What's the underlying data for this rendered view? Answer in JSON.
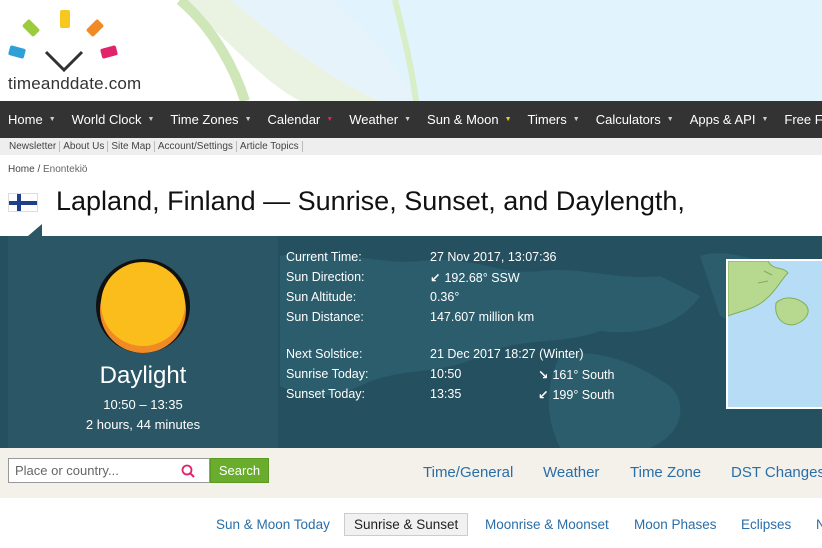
{
  "brand": {
    "logo_text": "timeanddate.com"
  },
  "nav": {
    "items": [
      {
        "label": "Home",
        "caret": "white"
      },
      {
        "label": "World Clock",
        "caret": "white"
      },
      {
        "label": "Time Zones",
        "caret": "white"
      },
      {
        "label": "Calendar",
        "caret": "red"
      },
      {
        "label": "Weather",
        "caret": "white"
      },
      {
        "label": "Sun & Moon",
        "caret": "yellow"
      },
      {
        "label": "Timers",
        "caret": "white"
      },
      {
        "label": "Calculators",
        "caret": "white"
      },
      {
        "label": "Apps & API",
        "caret": "white"
      },
      {
        "label": "Free Fun",
        "caret": "white"
      }
    ]
  },
  "subnav": {
    "items": [
      "Newsletter",
      "About Us",
      "Site Map",
      "Account/Settings",
      "Article Topics"
    ]
  },
  "breadcrumb": {
    "home": "Home /",
    "current": "Enontekiö"
  },
  "title": "Lapland, Finland — Sunrise, Sunset, and Daylength,",
  "sun": {
    "status": "Daylight",
    "range": "10:50 – 13:35",
    "duration": "2 hours, 44 minutes"
  },
  "info": {
    "current_time_label": "Current Time:",
    "current_time_value": "27 Nov 2017, 13:07:36",
    "direction_label": "Sun Direction:",
    "direction_value": "192.68° SSW",
    "altitude_label": "Sun Altitude:",
    "altitude_value": "0.36°",
    "distance_label": "Sun Distance:",
    "distance_value": "147.607 million km",
    "solstice_label": "Next Solstice:",
    "solstice_value": "21 Dec 2017 18:27 (Winter)",
    "sunrise_label": "Sunrise Today:",
    "sunrise_value": "10:50",
    "sunrise_dir": "161° South",
    "sunset_label": "Sunset Today:",
    "sunset_value": "13:35",
    "sunset_dir": "199° South"
  },
  "search": {
    "placeholder": "Place or country...",
    "button": "Search"
  },
  "tabs": [
    "Time/General",
    "Weather",
    "Time Zone",
    "DST Changes"
  ],
  "sublinks": [
    "Sun & Moon Today",
    "Sunrise & Sunset",
    "Moonrise & Moonset",
    "Moon Phases",
    "Eclipses",
    "N"
  ],
  "colors": {
    "nav_bg": "#333333",
    "banner_bg": "#25505f",
    "search_green": "#6aad2d",
    "link_blue": "#2a6ea8",
    "sun_yellow": "#fbbd1c"
  }
}
